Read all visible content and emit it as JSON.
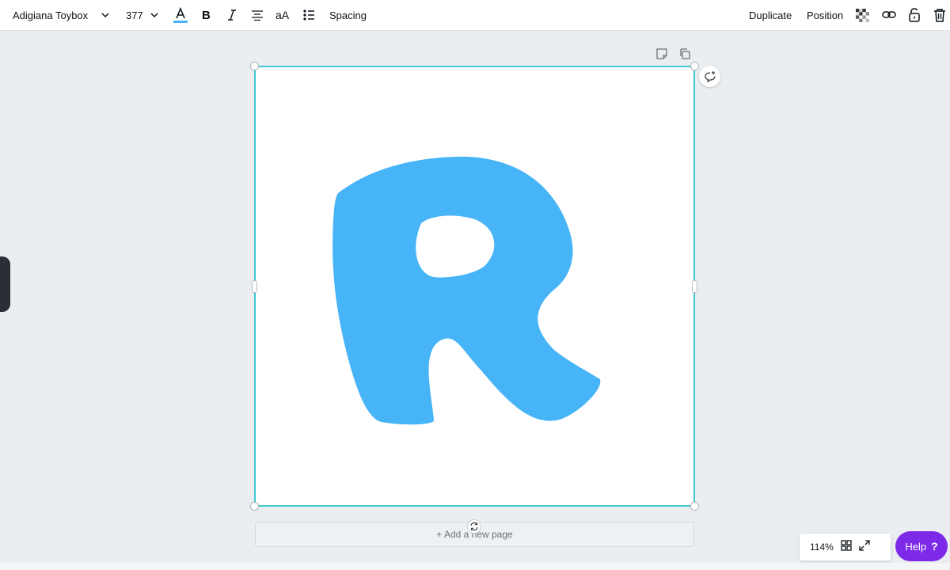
{
  "toolbar": {
    "font_family": "Adigiana Toybox",
    "font_size": "377",
    "spacing_label": "Spacing",
    "text_case_label": "aA",
    "duplicate_label": "Duplicate",
    "position_label": "Position",
    "text_color": "#46b4f7"
  },
  "canvas": {
    "letter": "R",
    "letter_color": "#46b4f7",
    "selection_color": "#41c7d3",
    "add_page_label": "+ Add a new page"
  },
  "footer": {
    "zoom": "114%",
    "help_label": "Help",
    "help_icon": "?",
    "help_color": "#7d2ae8"
  }
}
